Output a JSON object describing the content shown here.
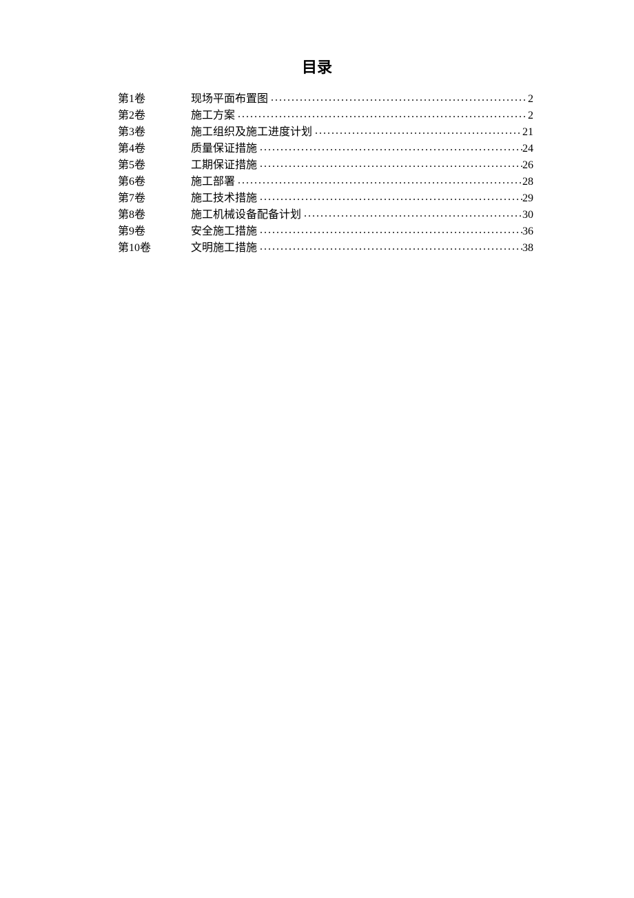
{
  "title": "目录",
  "toc": [
    {
      "volume": "第1卷",
      "title": "现场平面布置图",
      "page": "2"
    },
    {
      "volume": "第2卷",
      "title": "施工方案",
      "page": "2"
    },
    {
      "volume": "第3卷",
      "title": "施工组织及施工进度计划",
      "page": "21"
    },
    {
      "volume": "第4卷",
      "title": "质量保证措施",
      "page": "24"
    },
    {
      "volume": "第5卷",
      "title": "工期保证措施",
      "page": "26"
    },
    {
      "volume": "第6卷",
      "title": "施工部署",
      "page": "28"
    },
    {
      "volume": "第7卷",
      "title": "施工技术措施",
      "page": "29"
    },
    {
      "volume": "第8卷",
      "title": "施工机械设备配备计划",
      "page": "30"
    },
    {
      "volume": "第9卷",
      "title": "安全施工措施",
      "page": "36"
    },
    {
      "volume": "第10卷",
      "title": "文明施工措施",
      "page": "38"
    }
  ]
}
